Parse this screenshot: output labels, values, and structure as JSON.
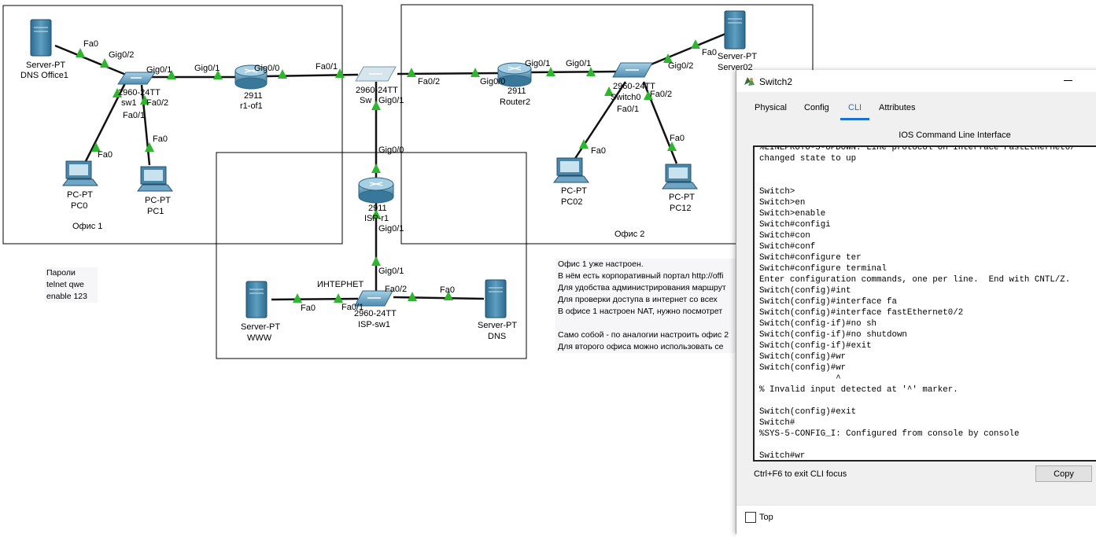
{
  "labels": {
    "server_dns_office1_type": "Server-PT",
    "server_dns_office1_name": "DNS Office1",
    "sw1_fa0_to_server": "Fa0",
    "sw1_gig02": "Gig0/2",
    "sw1_gig01": "Gig0/1",
    "sw1_model": "2960-24TT",
    "sw1_name": "sw1",
    "sw1_fa02": "Fa0/2",
    "sw1_fa01": "Fa0/1",
    "pc0_fa0": "Fa0",
    "pc1_fa0": "Fa0",
    "pc0_type": "PC-PT",
    "pc0_name": "PC0",
    "pc1_type": "PC-PT",
    "pc1_name": "PC1",
    "office1_label": "Офис 1",
    "r1_gig01": "Gig0/1",
    "r1_gig00": "Gig0/0",
    "r1_model": "2911",
    "r1_name": "r1-of1",
    "sw_fa01": "Fa0/1",
    "sw_model": "2960-24TT",
    "sw_name": "Sw",
    "sw_gig01": "Gig0/1",
    "sw_fa02": "Fa0/2",
    "router2_gig00": "Gig0/0",
    "router2_gig01": "Gig0/1",
    "router2_model": "2911",
    "router2_name": "Router2",
    "switch0_gig01": "Gig0/1",
    "switch0_gig02": "Gig0/2",
    "switch0_model": "2960-24TT",
    "switch0_name": "Switch0",
    "switch0_fa02": "Fa0/2",
    "switch0_fa01": "Fa0/1",
    "server02_fa0": "Fa0",
    "server02_type": "Server-PT",
    "server02_name": "Server02",
    "pc02_fa0": "Fa0",
    "pc12_fa0": "Fa0",
    "pc02_type": "PC-PT",
    "pc02_name": "PC02",
    "pc12_type": "PC-PT",
    "pc12_name": "PC12",
    "office2_label": "Офис 2",
    "isp_gig00": "Gig0/0",
    "isp_model": "2911",
    "isp_name": "ISP-r1",
    "isp_gig01": "Gig0/1",
    "ispsw_gig01": "Gig0/1",
    "internet_label": "ИНТЕРНЕТ",
    "ispsw_fa01": "Fa0/1",
    "ispsw_fa02": "Fa0/2",
    "ispsw_model": "2960-24TT",
    "ispsw_name": "ISP-sw1",
    "www_fa0": "Fa0",
    "www_type": "Server-PT",
    "www_name": "WWW",
    "dns_fa0": "Fa0",
    "dns_type": "Server-PT",
    "dns_name": "DNS"
  },
  "notes": {
    "passwords": [
      "Пароли",
      "telnet qwe",
      "enable 123"
    ],
    "office_info": [
      "Офис 1 уже настроен.",
      "В нём есть корпоративный портал http://offi",
      "Для удобства администрирования маршрут",
      "Для проверки доступа в интернет со всех",
      "В офисе 1 настроен NAT, нужно посмотрет",
      "",
      "Само собой - по аналогии настроить офис 2",
      "Для второго офиса можно использовать се"
    ]
  },
  "dialog": {
    "title": "Switch2",
    "tabs": [
      {
        "label": "Physical",
        "active": false
      },
      {
        "label": "Config",
        "active": false
      },
      {
        "label": "CLI",
        "active": true
      },
      {
        "label": "Attributes",
        "active": false
      }
    ],
    "cli_header": "IOS Command Line Interface",
    "console_lines": [
      "%LINEPROTO-5-UPDOWN: Line protocol on Interface FastEthernet0/",
      "changed state to up",
      "",
      "",
      "Switch>",
      "Switch>en",
      "Switch>enable",
      "Switch#configi",
      "Switch#con",
      "Switch#conf",
      "Switch#configure ter",
      "Switch#configure terminal",
      "Enter configuration commands, one per line.  End with CNTL/Z.",
      "Switch(config)#int",
      "Switch(config)#interface fa",
      "Switch(config)#interface fastEthernet0/2",
      "Switch(config-if)#no sh",
      "Switch(config-if)#no shutdown",
      "Switch(config-if)#exit",
      "Switch(config)#wr",
      "Switch(config)#wr",
      "               ^",
      "% Invalid input detected at '^' marker.",
      "",
      "Switch(config)#exit",
      "Switch#",
      "%SYS-5-CONFIG_I: Configured from console by console",
      "",
      "Switch#wr"
    ],
    "hint": "Ctrl+F6 to exit CLI focus",
    "copy_label": "Copy",
    "top_label": "Top",
    "top_checked": false
  },
  "colors": {
    "link": "#1a1a1a",
    "link_ok": "#2fb52f",
    "device_blue": "#3f7ea3",
    "accent": "#1d6fd1"
  }
}
